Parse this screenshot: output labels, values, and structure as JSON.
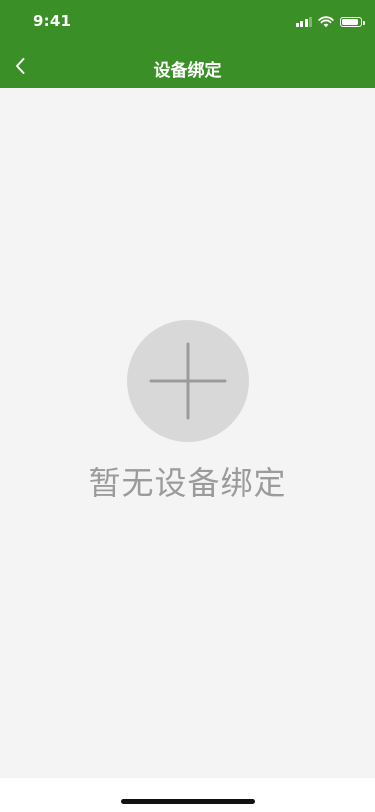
{
  "status_bar": {
    "time": "9:41",
    "signal_bars_active": 3,
    "battery_level": 0.9
  },
  "nav": {
    "title": "设备绑定",
    "back_icon": "chevron-left-icon"
  },
  "empty_state": {
    "icon": "plus-icon",
    "message": "暂无设备绑定"
  },
  "colors": {
    "nav_background": "#3a8f26",
    "content_background": "#f4f4f4",
    "add_circle": "#d8d8d8",
    "plus_stroke": "#9b9b9b",
    "message_text": "#9b9b9b"
  }
}
